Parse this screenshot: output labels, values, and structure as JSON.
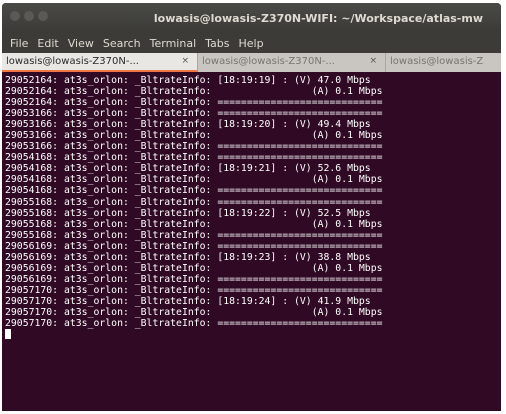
{
  "window": {
    "title": "lowasis@lowasis-Z370N-WIFI: ~/Workspace/atlas-mw"
  },
  "menu": [
    "File",
    "Edit",
    "View",
    "Search",
    "Terminal",
    "Tabs",
    "Help"
  ],
  "tabs": [
    {
      "label": "lowasis@lowasis-Z370N-...",
      "close": "×",
      "active": true
    },
    {
      "label": "lowasis@lowasis-Z370N-...",
      "close": "×",
      "active": false
    },
    {
      "label": "lowasis@lowasis-Z",
      "close": "",
      "active": false
    }
  ],
  "terminal": {
    "lines": [
      "29052164: at3s_orlon: _BltrateInfo: [18:19:19] : (V) 47.0 Mbps",
      "29052164: at3s_orlon: _BltrateInfo:                 (A) 0.1 Mbps",
      "29052164: at3s_orlon: _BltrateInfo: ============================",
      "29053166: at3s_orlon: _BltrateInfo: ============================",
      "29053166: at3s_orlon: _BltrateInfo: [18:19:20] : (V) 49.4 Mbps",
      "29053166: at3s_orlon: _BltrateInfo:                 (A) 0.1 Mbps",
      "29053166: at3s_orlon: _BltrateInfo: ============================",
      "29054168: at3s_orlon: _BltrateInfo: ============================",
      "29054168: at3s_orlon: _BltrateInfo: [18:19:21] : (V) 52.6 Mbps",
      "29054168: at3s_orlon: _BltrateInfo:                 (A) 0.1 Mbps",
      "29054168: at3s_orlon: _BltrateInfo: ============================",
      "29055168: at3s_orlon: _BltrateInfo: ============================",
      "29055168: at3s_orlon: _BltrateInfo: [18:19:22] : (V) 52.5 Mbps",
      "29055168: at3s_orlon: _BltrateInfo:                 (A) 0.1 Mbps",
      "29055168: at3s_orlon: _BltrateInfo: ============================",
      "29056169: at3s_orlon: _BltrateInfo: ============================",
      "29056169: at3s_orlon: _BltrateInfo: [18:19:23] : (V) 38.8 Mbps",
      "29056169: at3s_orlon: _BltrateInfo:                 (A) 0.1 Mbps",
      "29056169: at3s_orlon: _BltrateInfo: ============================",
      "29057170: at3s_orlon: _BltrateInfo: ============================",
      "29057170: at3s_orlon: _BltrateInfo: [18:19:24] : (V) 41.9 Mbps",
      "29057170: at3s_orlon: _BltrateInfo:                 (A) 0.1 Mbps",
      "29057170: at3s_orlon: _BltrateInfo: ============================"
    ]
  },
  "colors": {
    "terminal_bg": "#300a24",
    "terminal_fg": "#ffffff",
    "titlebar_bg": "#3c3b37",
    "active_tab_accent": "#f07746"
  }
}
